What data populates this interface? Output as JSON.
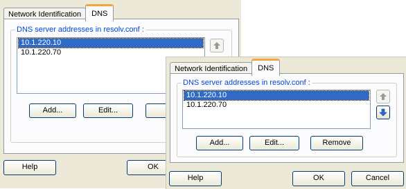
{
  "back": {
    "tabs": [
      "Network Identification",
      "DNS"
    ],
    "group_label": "DNS server addresses in resolv.conf :",
    "dns_list": [
      "10.1.220.10",
      "10.1.220.70"
    ],
    "buttons": {
      "add": "Add...",
      "edit": "Edit...",
      "remove": "Re"
    },
    "footer": {
      "help": "Help",
      "ok": "OK"
    }
  },
  "front": {
    "tabs": [
      "Network Identification",
      "DNS"
    ],
    "group_label": "DNS server addresses in resolv.conf :",
    "dns_list": [
      "10.1.220.10",
      "10.1.220.70"
    ],
    "buttons": {
      "add": "Add...",
      "edit": "Edit...",
      "remove": "Remove"
    },
    "footer": {
      "help": "Help",
      "ok": "OK",
      "cancel": "Cancel"
    }
  },
  "colors": {
    "accent_tab": "#f2a73d",
    "selection": "#316ac5",
    "group_label": "#0046d5"
  }
}
